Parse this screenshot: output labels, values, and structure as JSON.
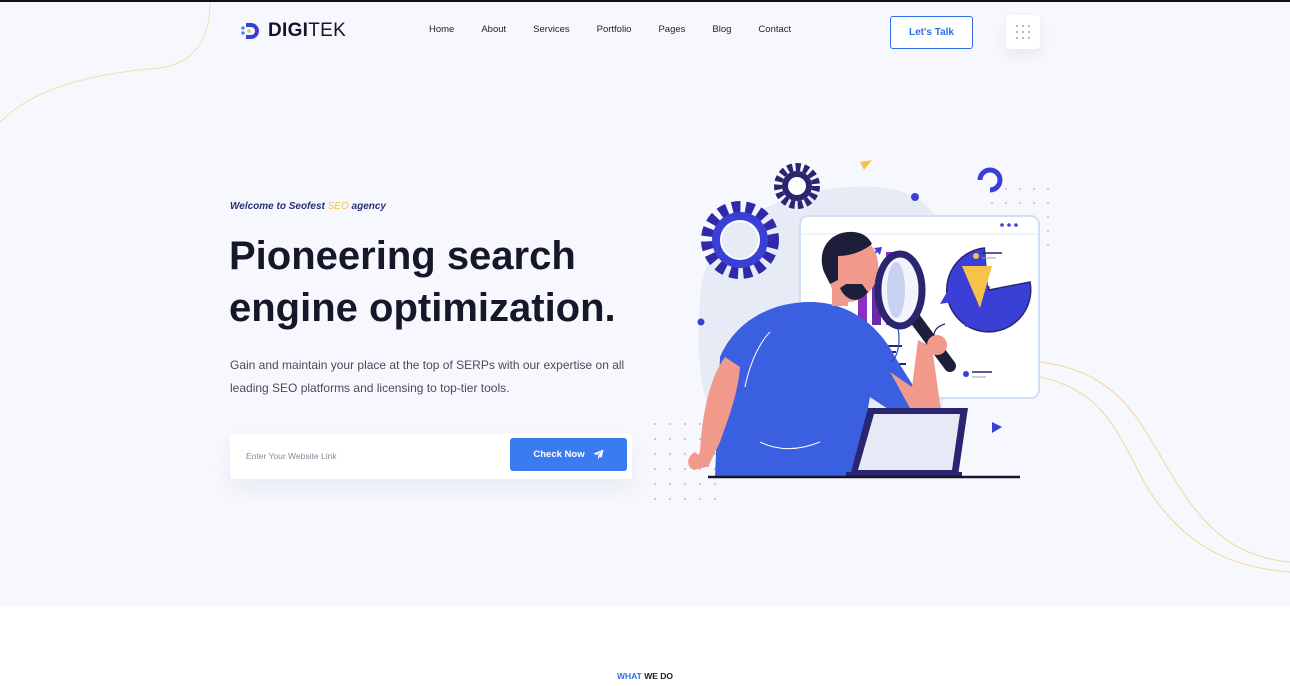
{
  "brand": {
    "name_bold": "DIGI",
    "name_light": "TEK"
  },
  "nav": {
    "items": [
      "Home",
      "About",
      "Services",
      "Portfolio",
      "Pages",
      "Blog",
      "Contact"
    ]
  },
  "header": {
    "cta_label": "Let's Talk",
    "menu_icon": "grid-menu-icon"
  },
  "hero": {
    "eyebrow_prefix": "Welcome to Seofest ",
    "eyebrow_highlight": "SEO",
    "eyebrow_suffix": " agency",
    "headline": "Pioneering search engine optimization.",
    "subtext": "Gain and maintain your place at the top of SERPs with our expertise on all leading SEO platforms and licensing to top-tier tools.",
    "search": {
      "placeholder": "Enter Your Website Link",
      "value": "",
      "button_label": "Check Now",
      "button_icon": "paper-plane-icon"
    }
  },
  "section_next": {
    "eyebrow_highlight": "WHAT",
    "eyebrow_rest": " WE DO"
  },
  "colors": {
    "accent": "#3a7bf0",
    "navy": "#2a2f78",
    "yellow": "#f6c34a",
    "background": "#f7f8fd"
  }
}
